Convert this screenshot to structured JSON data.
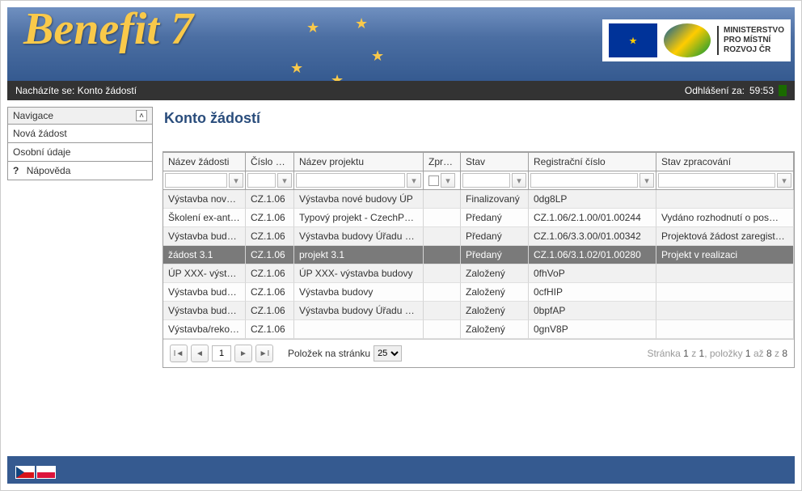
{
  "app_name": "Benefit 7",
  "ministry": {
    "line1": "MINISTERSTVO",
    "line2": "PRO MÍSTNÍ",
    "line3": "ROZVOJ ČR"
  },
  "breadcrumb": {
    "prefix": "Nacházíte se:",
    "location": "Konto žádostí"
  },
  "logout": {
    "label": "Odhlášení za:",
    "time": "59:53"
  },
  "nav": {
    "header": "Navigace",
    "items": [
      "Nová žádost",
      "Osobní údaje",
      "Nápověda"
    ]
  },
  "page_title": "Konto žádostí",
  "columns": [
    "Název žádosti",
    "Číslo OP",
    "Název projektu",
    "Zpráva",
    "Stav",
    "Registrační číslo",
    "Stav zpracování"
  ],
  "rows": [
    {
      "nazev": "Výstavba nové…",
      "cislo": "CZ.1.06",
      "projekt": "Výstavba nové budovy ÚP",
      "zprava": "",
      "stav": "Finalizovaný",
      "reg": "0dg8LP",
      "zprac": ""
    },
    {
      "nazev": "Školení ex-ante…",
      "cislo": "CZ.1.06",
      "projekt": "Typový projekt - CzechP…",
      "zprava": "",
      "stav": "Předaný",
      "reg": "CZ.1.06/2.1.00/01.00244",
      "zprac": "Vydáno rozhodnutí o pos…"
    },
    {
      "nazev": "Výstavba budov…",
      "cislo": "CZ.1.06",
      "projekt": "Výstavba budovy Úřadu p…",
      "zprava": "",
      "stav": "Předaný",
      "reg": "CZ.1.06/3.3.00/01.00342",
      "zprac": "Projektová žádost zaregist…"
    },
    {
      "nazev": "žádost 3.1",
      "cislo": "CZ.1.06",
      "projekt": "projekt 3.1",
      "zprava": "",
      "stav": "Předaný",
      "reg": "CZ.1.06/3.1.02/01.00280",
      "zprac": "Projekt v realizaci",
      "selected": true
    },
    {
      "nazev": "ÚP XXX- výstav…",
      "cislo": "CZ.1.06",
      "projekt": "ÚP XXX- výstavba budovy",
      "zprava": "",
      "stav": "Založený",
      "reg": "0fhVoP",
      "zprac": ""
    },
    {
      "nazev": "Výstavba budov…",
      "cislo": "CZ.1.06",
      "projekt": "Výstavba budovy",
      "zprava": "",
      "stav": "Založený",
      "reg": "0cfHIP",
      "zprac": ""
    },
    {
      "nazev": "Výstavba budov…",
      "cislo": "CZ.1.06",
      "projekt": "Výstavba budovy Úřadu p…",
      "zprava": "",
      "stav": "Založený",
      "reg": "0bpfAP",
      "zprac": ""
    },
    {
      "nazev": "Výstavba/rekon…",
      "cislo": "CZ.1.06",
      "projekt": "",
      "zprava": "",
      "stav": "Založený",
      "reg": "0gnV8P",
      "zprac": ""
    }
  ],
  "pager": {
    "items_per_page_label": "Položek na stránku",
    "items_per_page": "25",
    "current_page": "1",
    "summary_text": [
      "Stránka ",
      "1",
      " z ",
      "1",
      ", položky ",
      "1",
      " až ",
      "8",
      " z ",
      "8"
    ]
  }
}
